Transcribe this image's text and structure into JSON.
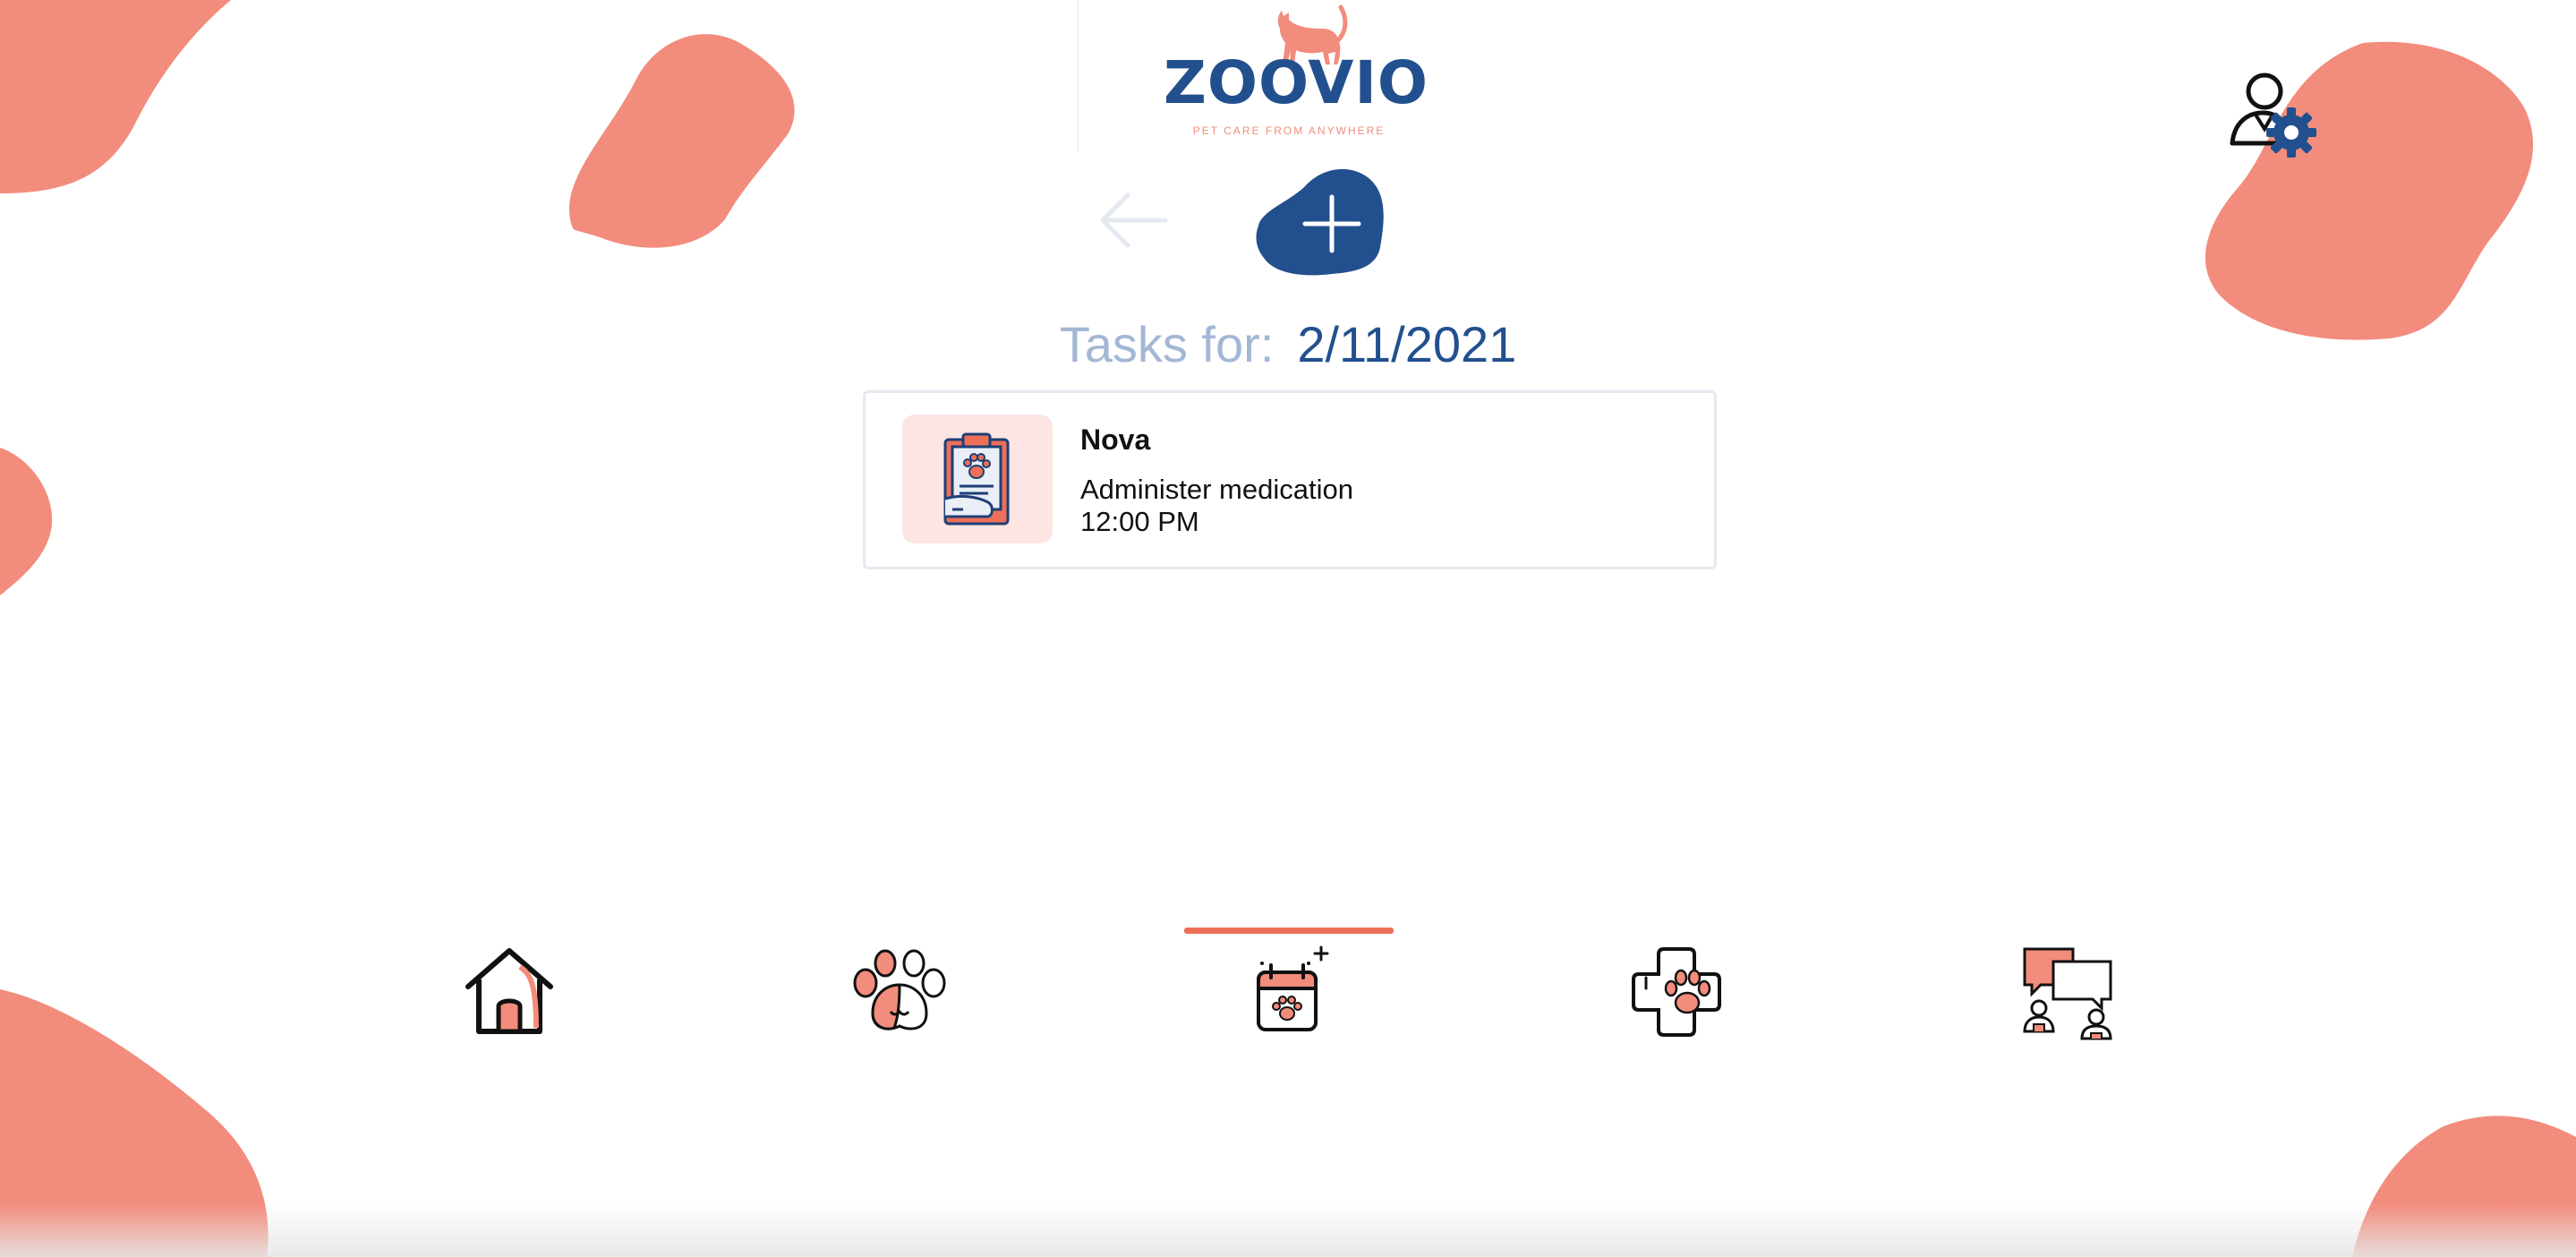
{
  "app": {
    "name": "ZOOVIO",
    "tagline": "PET CARE FROM ANYWHERE"
  },
  "theme": {
    "accent": "#f28c7c",
    "brand": "#22508f",
    "muted": "#a3b7d5",
    "active": "#ee6f57"
  },
  "header": {
    "profile_icon": "user-settings-icon",
    "back_icon": "arrow-left-icon",
    "add_icon": "plus-icon"
  },
  "tasks": {
    "label": "Tasks for:",
    "date": "2/11/2021",
    "items": [
      {
        "pet": "Nova",
        "description": "Administer medication",
        "time": "12:00 PM",
        "icon": "clipboard-paw-icon"
      }
    ]
  },
  "nav": {
    "items": [
      {
        "id": "home",
        "icon": "house-icon"
      },
      {
        "id": "pets",
        "icon": "paw-icon"
      },
      {
        "id": "calendar",
        "icon": "calendar-paw-icon",
        "active": true
      },
      {
        "id": "vet",
        "icon": "medical-paw-icon"
      },
      {
        "id": "chat",
        "icon": "chat-users-icon"
      }
    ]
  }
}
